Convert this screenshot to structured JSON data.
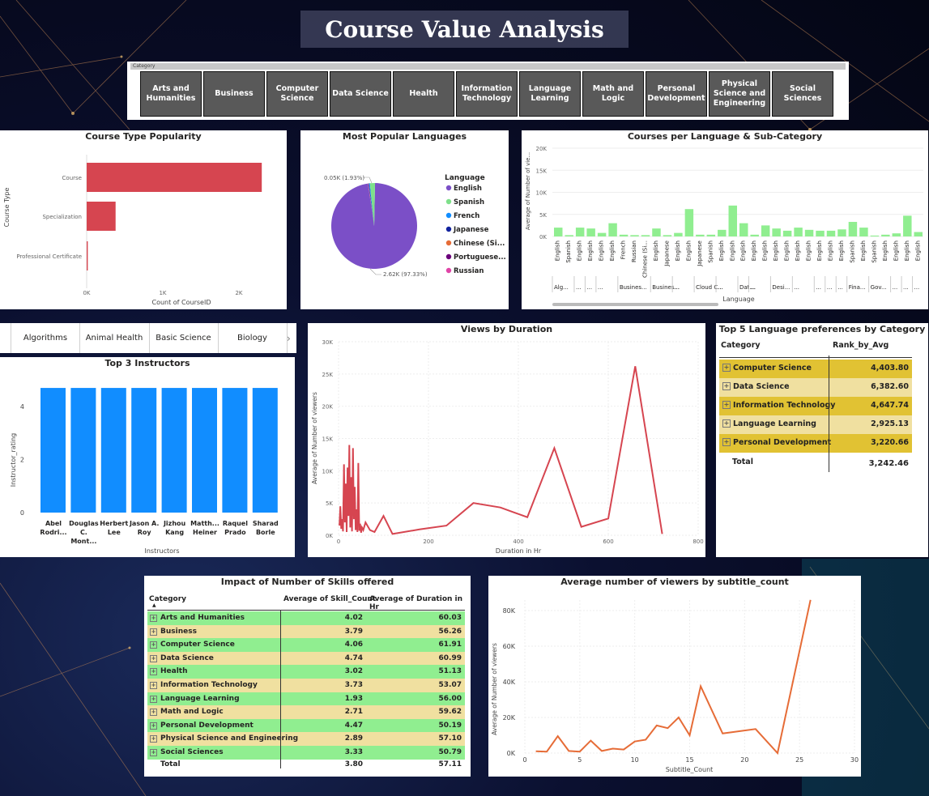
{
  "title": "Course Value Analysis",
  "slicer": {
    "caption": "Category",
    "items": [
      "Arts and Humanities",
      "Business",
      "Computer Science",
      "Data Science",
      "Health",
      "Information Technology",
      "Language Learning",
      "Math and Logic",
      "Personal Development",
      "Physical Science and Engineering",
      "Social Sciences"
    ]
  },
  "course_type": {
    "title": "Course Type Popularity",
    "ylabel": "Course Type",
    "xlabel": "Count of CourseID",
    "categories": [
      "Course",
      "Specialization",
      "Professional Certificate"
    ],
    "values": [
      2300,
      380,
      15
    ],
    "ticks": [
      "0K",
      "1K",
      "2K"
    ],
    "color": "#d64550"
  },
  "languages_pie": {
    "title": "Most Popular Languages",
    "legend_title": "Language",
    "legend": [
      {
        "name": "English",
        "color": "#7b4fc7"
      },
      {
        "name": "Spanish",
        "color": "#7ee08a"
      },
      {
        "name": "French",
        "color": "#118dff"
      },
      {
        "name": "Japanese",
        "color": "#12239e"
      },
      {
        "name": "Chinese (Si...",
        "color": "#e66c37"
      },
      {
        "name": "Portuguese...",
        "color": "#6b007b"
      },
      {
        "name": "Russian",
        "color": "#e044a7"
      }
    ],
    "label_small": "0.05K (1.93%)",
    "label_big": "2.62K (97.33%)",
    "values": [
      97.33,
      1.93,
      0.3,
      0.2,
      0.1,
      0.08,
      0.06
    ]
  },
  "lang_subcat": {
    "title": "Courses per Language & Sub-Category",
    "ylabel": "Average of Number of vie...",
    "xlabel": "Language",
    "yticks": [
      "0K",
      "5K",
      "10K",
      "15K",
      "20K"
    ],
    "langs": [
      "English",
      "Spanish",
      "English",
      "English",
      "English",
      "English",
      "French",
      "Russian",
      "Chinese (Si...",
      "English",
      "Japanese",
      "English",
      "English",
      "Japanese",
      "Spanish",
      "English",
      "English",
      "English",
      "English",
      "English",
      "English",
      "English",
      "English",
      "English",
      "English",
      "English",
      "English",
      "Spanish",
      "English",
      "Spanish",
      "English",
      "English",
      "English",
      "English"
    ],
    "values": [
      2000,
      300,
      2000,
      1800,
      800,
      3000,
      400,
      300,
      300,
      1800,
      300,
      800,
      6200,
      400,
      400,
      1500,
      7000,
      3000,
      400,
      2500,
      1800,
      1300,
      2000,
      1500,
      1300,
      1300,
      1600,
      3300,
      2000,
      200,
      400,
      700,
      4700,
      1000
    ],
    "groups": [
      {
        "label": "Alg...",
        "i": 0
      },
      {
        "label": "...",
        "i": 2
      },
      {
        "label": "...",
        "i": 3
      },
      {
        "label": "...",
        "i": 4
      },
      {
        "label": "Busines...",
        "i": 6
      },
      {
        "label": "Busines...",
        "i": 9
      },
      {
        "label": "...",
        "i": 11
      },
      {
        "label": "Cloud C...",
        "i": 13
      },
      {
        "label": "...",
        "i": 15
      },
      {
        "label": "Dat...",
        "i": 17
      },
      {
        "label": "...",
        "i": 18
      },
      {
        "label": "Desi...",
        "i": 20
      },
      {
        "label": "...",
        "i": 22
      },
      {
        "label": "...",
        "i": 24
      },
      {
        "label": "...",
        "i": 25
      },
      {
        "label": "...",
        "i": 26
      },
      {
        "label": "Fina...",
        "i": 27
      },
      {
        "label": "Gov...",
        "i": 29
      },
      {
        "label": "...",
        "i": 31
      },
      {
        "label": "...",
        "i": 32
      },
      {
        "label": "...",
        "i": 33
      }
    ],
    "color": "#90ee90"
  },
  "subcat_strip": [
    "Algorithms",
    "Animal Health",
    "Basic Science",
    "Biology"
  ],
  "instructors": {
    "title": "Top 3 Instructors",
    "ylabel": "Instructor_rating",
    "xlabel": "Instructors",
    "yticks": [
      "0",
      "2",
      "4"
    ],
    "names": [
      [
        "Abel",
        "Rodri..."
      ],
      [
        "Douglas",
        "C.",
        "Mont..."
      ],
      [
        "Herbert",
        "Lee"
      ],
      [
        "Jason A.",
        "Roy"
      ],
      [
        "Jizhou",
        "Kang"
      ],
      [
        "Matth...",
        "Heiner"
      ],
      [
        "Raquel",
        "Prado"
      ],
      [
        "Sharad",
        "Borle"
      ]
    ],
    "values": [
      4.7,
      4.7,
      4.7,
      4.7,
      4.7,
      4.7,
      4.7,
      4.7
    ],
    "color": "#118dff"
  },
  "views_duration": {
    "title": "Views by Duration",
    "ylabel": "Average of Number of viewers",
    "xlabel": "Duration in Hr",
    "yticks": [
      "0K",
      "5K",
      "10K",
      "15K",
      "20K",
      "25K",
      "30K"
    ],
    "xticks": [
      "0",
      "200",
      "400",
      "600",
      "800"
    ],
    "x": [
      2,
      4,
      6,
      8,
      10,
      12,
      14,
      16,
      18,
      20,
      22,
      24,
      26,
      28,
      30,
      32,
      34,
      36,
      38,
      40,
      42,
      44,
      46,
      48,
      50,
      52,
      55,
      60,
      70,
      80,
      100,
      120,
      180,
      240,
      300,
      360,
      420,
      480,
      540,
      600,
      660,
      720
    ],
    "y": [
      1500,
      4500,
      1000,
      2500,
      600,
      11000,
      2000,
      8000,
      500,
      10500,
      3000,
      14000,
      1200,
      9000,
      600,
      13500,
      2500,
      7500,
      800,
      4000,
      500,
      11200,
      700,
      1800,
      400,
      1200,
      800,
      2000,
      800,
      500,
      3000,
      200,
      900,
      1500,
      5000,
      4300,
      2800,
      13500,
      1300,
      2600,
      26200,
      200
    ],
    "color": "#d64550"
  },
  "lang_pref": {
    "title": "Top 5 Language preferences by Category",
    "col1": "Category",
    "col2": "Rank_by_Avg",
    "rows": [
      {
        "cat": "Computer Science",
        "val": "4,403.80"
      },
      {
        "cat": "Data Science",
        "val": "6,382.60"
      },
      {
        "cat": "Information Technology",
        "val": "4,647.74"
      },
      {
        "cat": "Language Learning",
        "val": "2,925.13"
      },
      {
        "cat": "Personal Development",
        "val": "3,220.66"
      }
    ],
    "total_label": "Total",
    "total": "3,242.46",
    "c_dark": "#e1c233",
    "c_light": "#f0e0a0"
  },
  "skills": {
    "title": "Impact of Number of Skills offered",
    "col1": "Category",
    "col2": "Average of Skill_Count",
    "col3": "Average of Duration in Hr",
    "rows": [
      {
        "cat": "Arts and Humanities",
        "skill": "4.02",
        "dur": "60.03"
      },
      {
        "cat": "Business",
        "skill": "3.79",
        "dur": "56.26"
      },
      {
        "cat": "Computer Science",
        "skill": "4.06",
        "dur": "61.91"
      },
      {
        "cat": "Data Science",
        "skill": "4.74",
        "dur": "60.99"
      },
      {
        "cat": "Health",
        "skill": "3.02",
        "dur": "51.13"
      },
      {
        "cat": "Information Technology",
        "skill": "3.73",
        "dur": "53.07"
      },
      {
        "cat": "Language Learning",
        "skill": "1.93",
        "dur": "56.00"
      },
      {
        "cat": "Math and Logic",
        "skill": "2.71",
        "dur": "59.62"
      },
      {
        "cat": "Personal Development",
        "skill": "4.47",
        "dur": "50.19"
      },
      {
        "cat": "Physical Science and Engineering",
        "skill": "2.89",
        "dur": "57.10"
      },
      {
        "cat": "Social Sciences",
        "skill": "3.33",
        "dur": "50.79"
      }
    ],
    "total_label": "Total",
    "total_skill": "3.80",
    "total_dur": "57.11",
    "c_green": "#90ee90",
    "c_tan": "#f0e0a0"
  },
  "subtitle_chart": {
    "title": "Average number of viewers by subtitle_count",
    "ylabel": "Average of Number of viewers",
    "xlabel": "Subtitle_Count",
    "yticks": [
      "0K",
      "20K",
      "40K",
      "60K",
      "80K"
    ],
    "xticks": [
      "0",
      "5",
      "10",
      "15",
      "20",
      "25",
      "30"
    ],
    "x": [
      1,
      2,
      3,
      4,
      5,
      6,
      7,
      8,
      9,
      10,
      11,
      12,
      13,
      14,
      15,
      16,
      18,
      21,
      23,
      26
    ],
    "y": [
      1000,
      800,
      9500,
      1200,
      800,
      7000,
      1200,
      2500,
      2000,
      6500,
      7500,
      15500,
      14000,
      20000,
      10000,
      37500,
      11000,
      13500,
      0,
      86000
    ],
    "color": "#e66c37"
  }
}
